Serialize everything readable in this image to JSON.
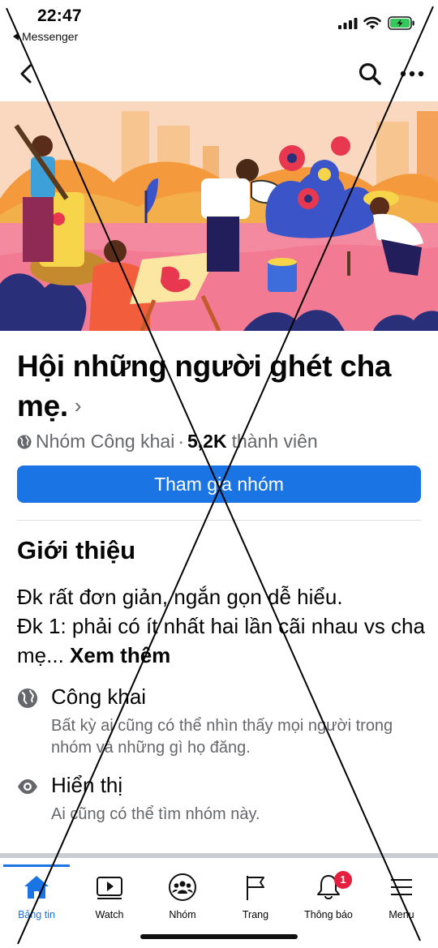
{
  "status_bar": {
    "time": "22:47",
    "back_app": "Messenger",
    "icons": [
      "signal-icon",
      "wifi-icon",
      "battery-charging-icon"
    ]
  },
  "nav": {
    "icons": [
      "back-chevron-icon",
      "search-icon",
      "more-icon"
    ]
  },
  "cover": {
    "description_icon": "cover-illustration"
  },
  "group": {
    "title": "Hội những người ghét cha mẹ.",
    "chevron": "›",
    "privacy": "Nhóm Công khai",
    "separator": "·",
    "member_count": "5,2K",
    "member_suffix": "thành viên",
    "join_label": "Tham gia nhóm"
  },
  "about": {
    "title": "Giới thiệu",
    "desc_line1": "Đk rất đơn giản, ngắn gọn dễ hiểu.",
    "desc_line2": "Đk 1: phải có ít nhất hai lần cãi nhau vs cha mẹ...",
    "see_more": "Xem thêm",
    "public": {
      "label": "Công khai",
      "desc": "Bất kỳ ai cũng có thể nhìn thấy mọi người trong nhóm và những gì họ đăng."
    },
    "visible": {
      "label": "Hiển thị",
      "desc": "Ai cũng có thể tìm nhóm này."
    }
  },
  "tabs": [
    {
      "label": "Bảng tin",
      "icon": "home-icon",
      "active": true
    },
    {
      "label": "Watch",
      "icon": "watch-icon"
    },
    {
      "label": "Nhóm",
      "icon": "groups-icon"
    },
    {
      "label": "Trang",
      "icon": "flag-icon"
    },
    {
      "label": "Thông báo",
      "icon": "bell-icon",
      "badge": "1"
    },
    {
      "label": "Menu",
      "icon": "menu-icon"
    }
  ],
  "colors": {
    "accent": "#1b74e4",
    "badge": "#e41e3f",
    "secondary_text": "#65676b"
  }
}
